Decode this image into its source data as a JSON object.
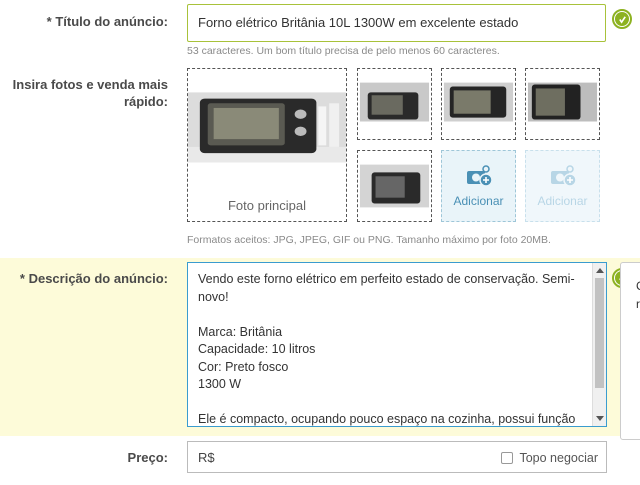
{
  "title_field": {
    "label": "* Título do anúncio:",
    "value": "Forno elétrico Britânia 10L 1300W em excelente estado",
    "hint": "53 caracteres. Um bom título precisa de pelo menos 60 caracteres."
  },
  "photos": {
    "label_line1": "Insira fotos e venda mais",
    "label_line2": "rápido:",
    "main_caption": "Foto principal",
    "add_label": "Adicionar",
    "add_label_disabled": "Adicionar",
    "formats_hint": "Formatos aceitos: JPG, JPEG, GIF ou PNG. Tamanho máximo por foto 20MB."
  },
  "description": {
    "label": "* Descrição do anúncio:",
    "text": "Vendo este forno elétrico em perfeito estado de conservação. Semi-\nnovo!\n\nMarca: Britânia\nCapacidade: 10 litros\nCor: Preto fosco\n1300 W\n\nEle é compacto, ocupando pouco espaço na cozinha, possui função",
    "side_tip_line1": "C",
    "side_tip_line2": "r"
  },
  "price": {
    "label": "Preço:",
    "prefix": "R$",
    "negotiate_label": "Topo negociar"
  },
  "colors": {
    "accent_green": "#8db221",
    "focus_blue": "#3a9ccf",
    "band_yellow": "#fdfbd9"
  },
  "icons": {
    "ok": "ok-hand-icon",
    "add_photo": "camera-plus-icon"
  }
}
